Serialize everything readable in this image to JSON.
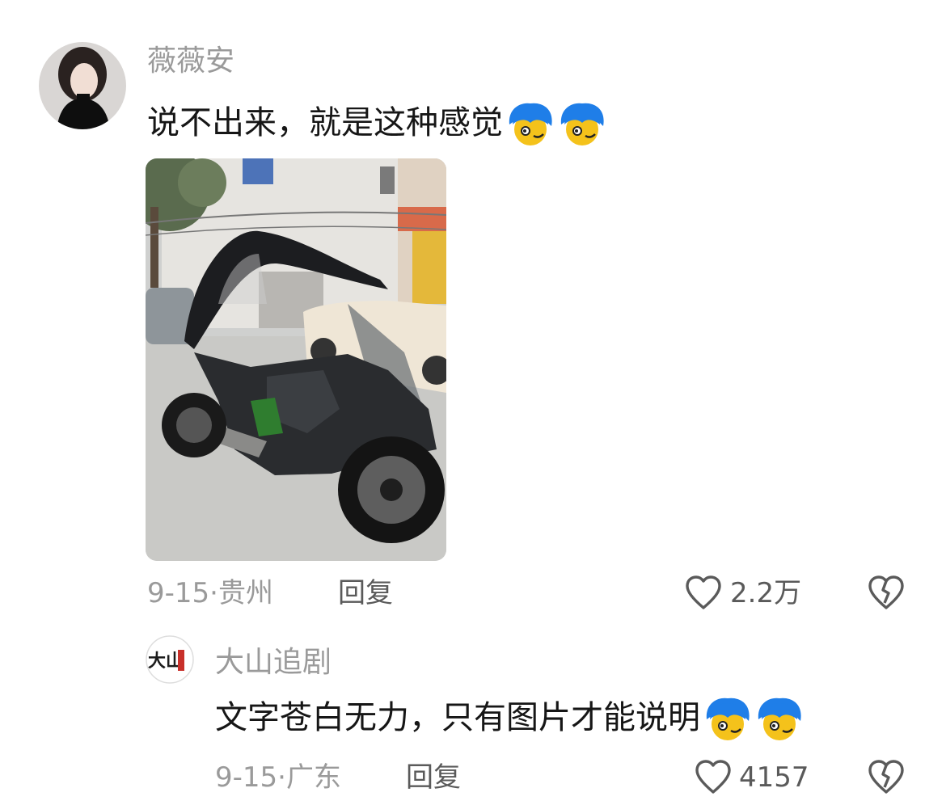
{
  "comments": [
    {
      "username": "薇薇安",
      "text": "说不出来，就是这种感觉",
      "emojis": [
        "blue-hair-smirk-emoji",
        "blue-hair-smirk-emoji"
      ],
      "date": "9-15",
      "location": "贵州",
      "reply_label": "回复",
      "likes": "2.2万",
      "avatar": "woman-portrait-avatar",
      "image": "motorcycle-with-umbrella-photo"
    },
    {
      "username": "大山追剧",
      "avatar_text": "大山",
      "text": "文字苍白无力，只有图片才能说明",
      "emojis": [
        "blue-hair-smirk-emoji",
        "blue-hair-smirk-emoji"
      ],
      "date": "9-15",
      "location": "广东",
      "reply_label": "回复",
      "likes": "4157"
    }
  ],
  "separator": "·",
  "icons": {
    "like": "heart-outline-icon",
    "dislike": "broken-heart-icon"
  },
  "colors": {
    "meta": "#9a9a9a",
    "text": "#161616",
    "action": "#5a5a5a",
    "emoji_hair": "#1f7ee8",
    "emoji_face": "#f4c21b"
  }
}
